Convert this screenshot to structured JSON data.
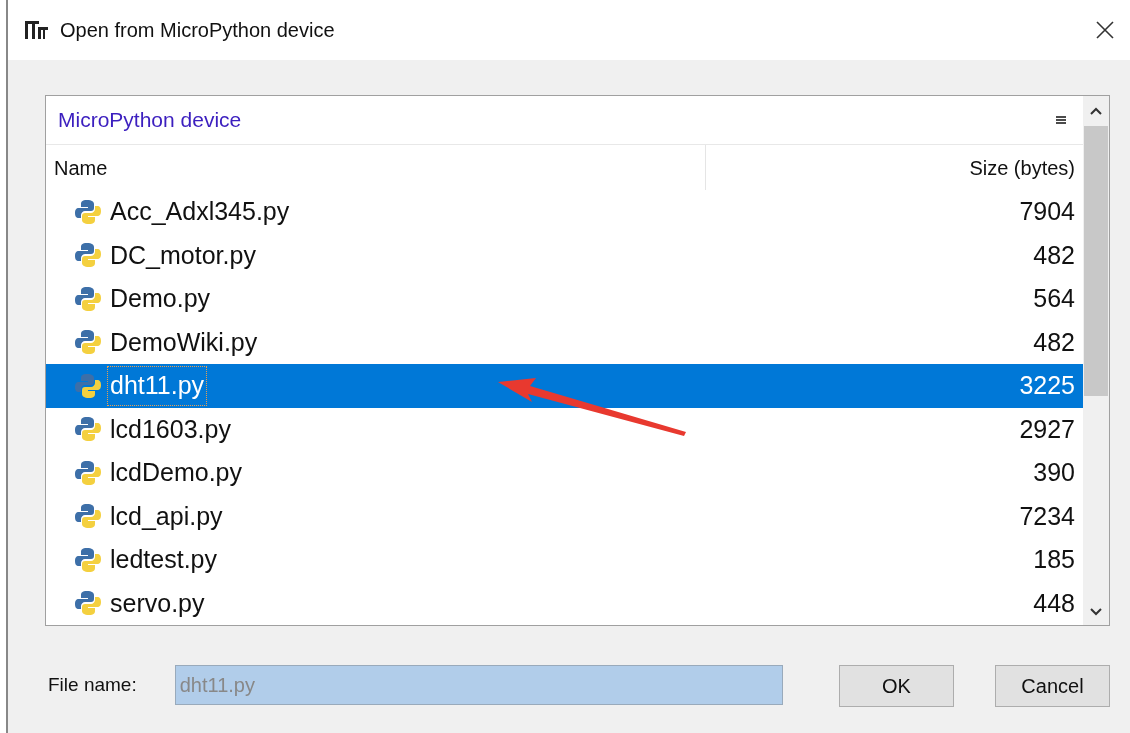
{
  "window": {
    "title": "Open from MicroPython device"
  },
  "location": {
    "title": "MicroPython device"
  },
  "table": {
    "columns": [
      "Name",
      "Size (bytes)"
    ],
    "rows": [
      {
        "name": "Acc_Adxl345.py",
        "size": "7904",
        "selected": false
      },
      {
        "name": "DC_motor.py",
        "size": "482",
        "selected": false
      },
      {
        "name": "Demo.py",
        "size": "564",
        "selected": false
      },
      {
        "name": "DemoWiki.py",
        "size": "482",
        "selected": false
      },
      {
        "name": "dht11.py",
        "size": "3225",
        "selected": true
      },
      {
        "name": "lcd1603.py",
        "size": "2927",
        "selected": false
      },
      {
        "name": "lcdDemo.py",
        "size": "390",
        "selected": false
      },
      {
        "name": "lcd_api.py",
        "size": "7234",
        "selected": false
      },
      {
        "name": "ledtest.py",
        "size": "185",
        "selected": false
      },
      {
        "name": "servo.py",
        "size": "448",
        "selected": false
      }
    ]
  },
  "file_name": {
    "label": "File name:",
    "value": "dht11.py"
  },
  "buttons": [
    "OK",
    "Cancel"
  ]
}
